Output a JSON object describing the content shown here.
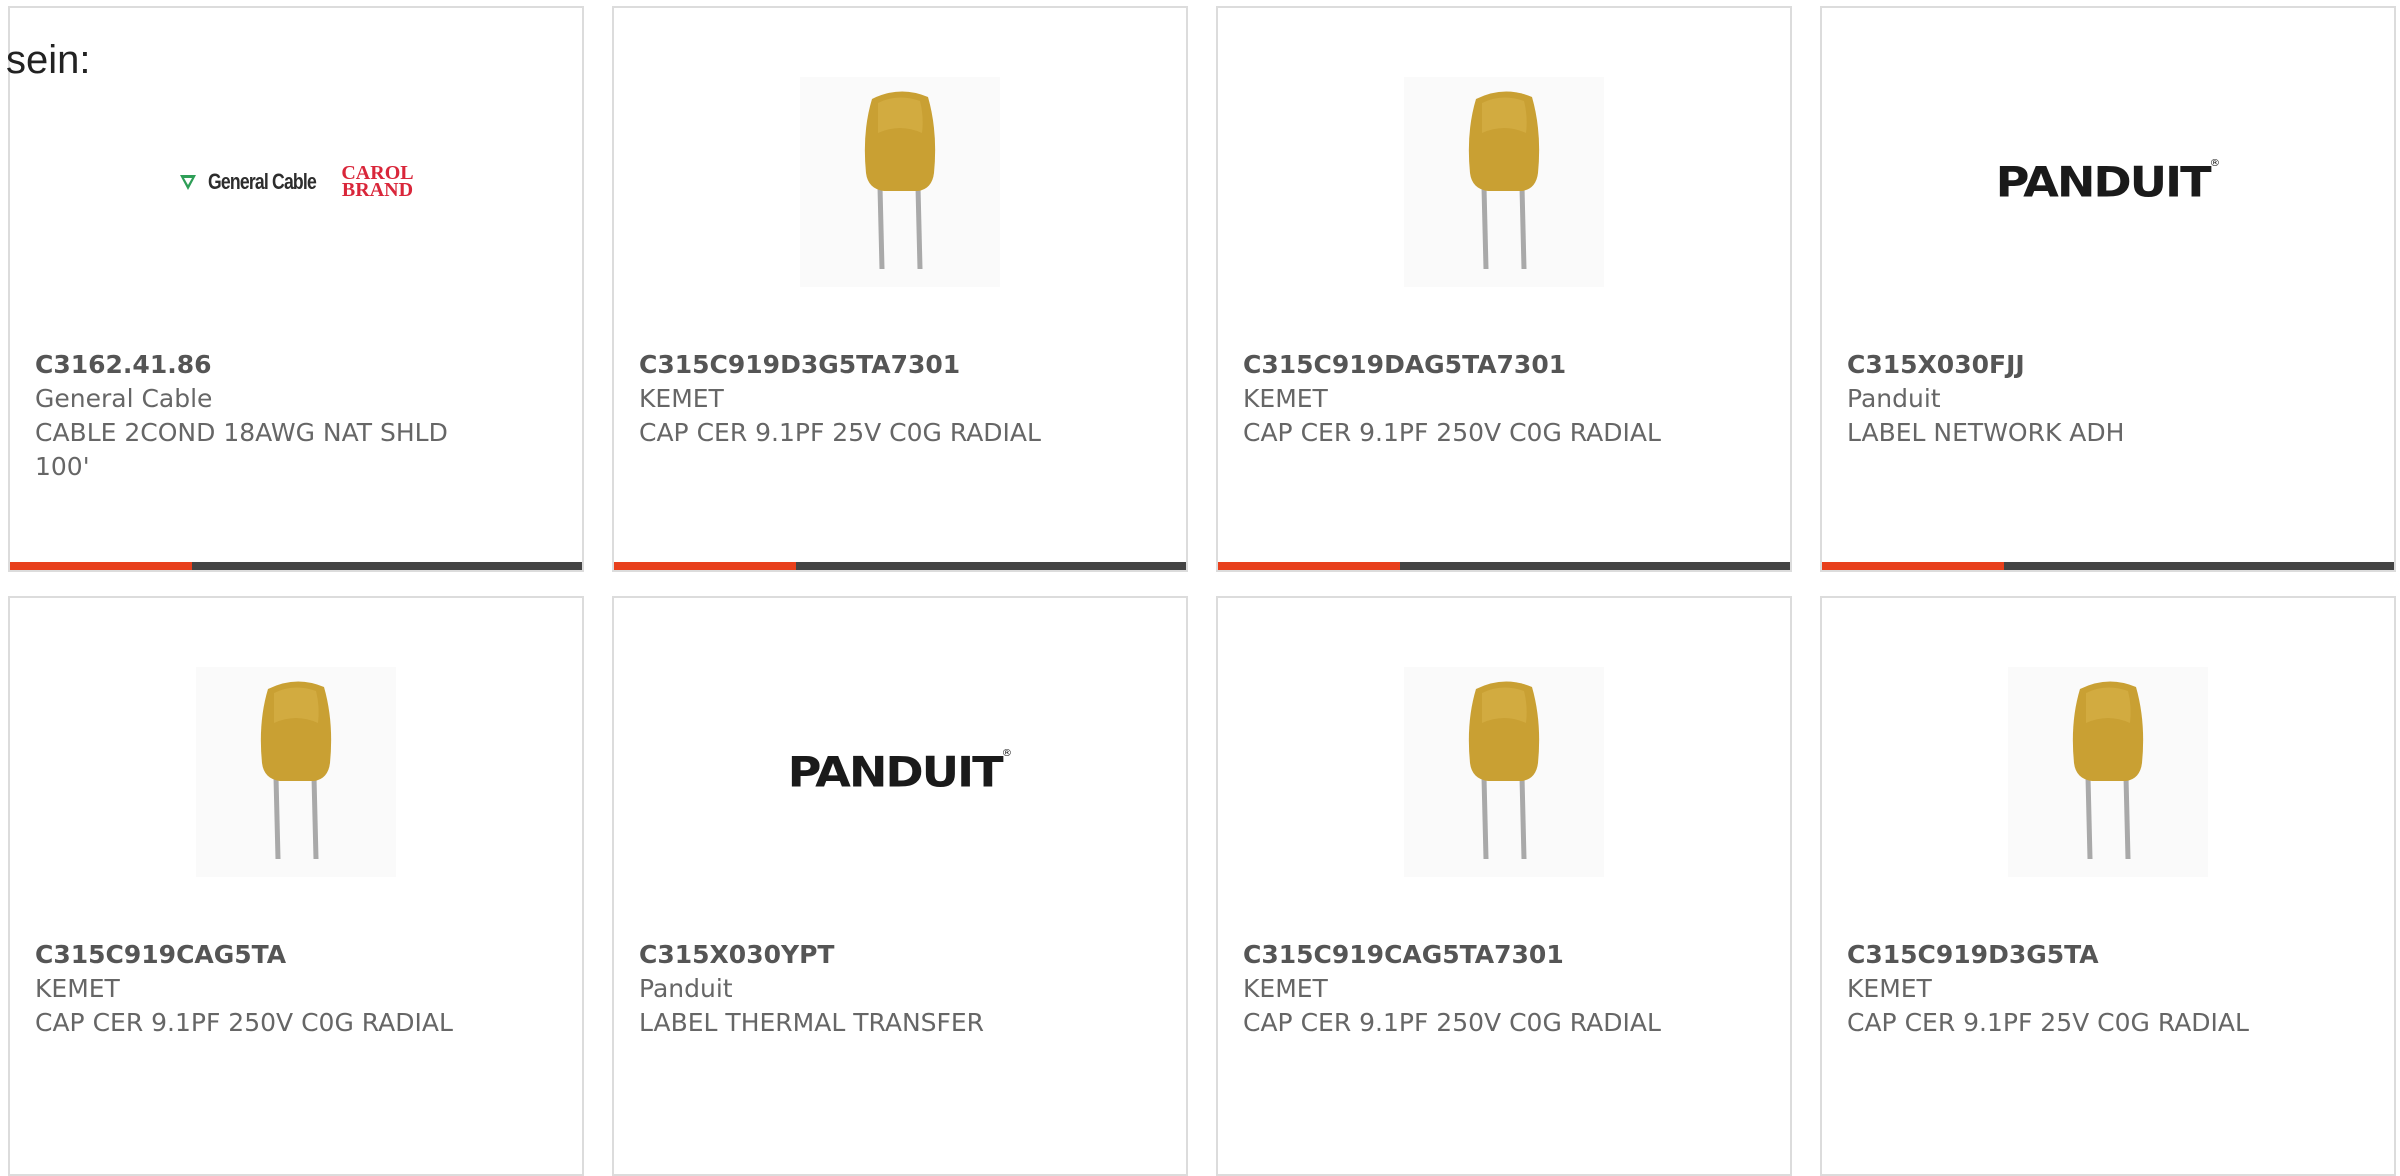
{
  "page_label": "sein:",
  "colors": {
    "accent": "#e8401c",
    "bar": "#444444",
    "border": "#dcdcdc",
    "text": "#666666"
  },
  "products": [
    {
      "part": "C3162.41.86",
      "manufacturer": "General Cable",
      "description": "CABLE 2COND 18AWG NAT SHLD 100'",
      "image": "general-cable-carol-brand-logo",
      "logo_text": {
        "name": "General Cable",
        "brand_top": "CAROL",
        "brand_bottom": "BRAND"
      }
    },
    {
      "part": "C315C919D3G5TA7301",
      "manufacturer": "KEMET",
      "description": "CAP CER 9.1PF 25V C0G RADIAL",
      "image": "ceramic-capacitor-photo"
    },
    {
      "part": "C315C919DAG5TA7301",
      "manufacturer": "KEMET",
      "description": "CAP CER 9.1PF 250V C0G RADIAL",
      "image": "ceramic-capacitor-photo"
    },
    {
      "part": "C315X030FJJ",
      "manufacturer": "Panduit",
      "description": "LABEL NETWORK ADH",
      "image": "panduit-logo",
      "logo_text": {
        "name": "PANDUIT"
      }
    },
    {
      "part": "C315C919CAG5TA",
      "manufacturer": "KEMET",
      "description": "CAP CER 9.1PF 250V C0G RADIAL",
      "image": "ceramic-capacitor-photo"
    },
    {
      "part": "C315X030YPT",
      "manufacturer": "Panduit",
      "description": "LABEL THERMAL TRANSFER",
      "image": "panduit-logo",
      "logo_text": {
        "name": "PANDUIT"
      }
    },
    {
      "part": "C315C919CAG5TA7301",
      "manufacturer": "KEMET",
      "description": "CAP CER 9.1PF 250V C0G RADIAL",
      "image": "ceramic-capacitor-photo"
    },
    {
      "part": "C315C919D3G5TA",
      "manufacturer": "KEMET",
      "description": "CAP CER 9.1PF 25V C0G RADIAL",
      "image": "ceramic-capacitor-photo"
    }
  ]
}
